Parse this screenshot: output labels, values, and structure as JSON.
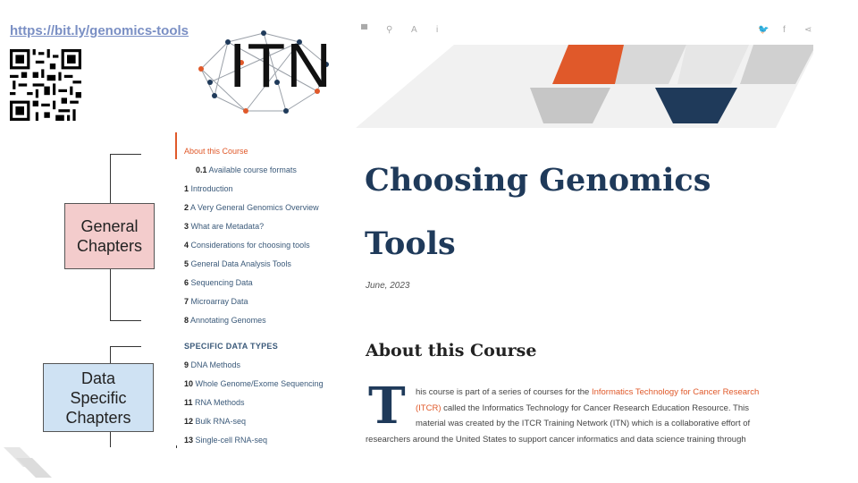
{
  "slide": {
    "link_text": "https://bit.ly/genomics-tools",
    "logo_text": "ITN",
    "callouts": {
      "general": "General\nChapters",
      "data_specific": "Data\nSpecific\nChapters"
    }
  },
  "toolbar": {
    "left_icons": [
      "sidebar-toggle-icon",
      "search-icon",
      "font-icon",
      "info-icon"
    ],
    "right_icons": [
      "twitter-icon",
      "facebook-icon",
      "share-icon"
    ],
    "glyphs": {
      "sidebar": "▀",
      "search": "⚲",
      "font": "A",
      "info": "i",
      "twitter": "🐦",
      "facebook": "f",
      "share": "⋖"
    }
  },
  "sidebar": {
    "items": [
      {
        "num": "",
        "label": "About this Course",
        "active": true
      },
      {
        "num": "0.1",
        "label": "Available course formats"
      },
      {
        "num": "1",
        "label": "Introduction"
      },
      {
        "num": "2",
        "label": "A Very General Genomics Overview"
      },
      {
        "num": "3",
        "label": "What are Metadata?"
      },
      {
        "num": "4",
        "label": "Considerations for choosing tools"
      },
      {
        "num": "5",
        "label": "General Data Analysis Tools"
      },
      {
        "num": "6",
        "label": "Sequencing Data"
      },
      {
        "num": "7",
        "label": "Microarray Data"
      },
      {
        "num": "8",
        "label": "Annotating Genomes"
      }
    ],
    "section_header": "SPECIFIC DATA TYPES",
    "specific_items": [
      {
        "num": "9",
        "label": "DNA Methods"
      },
      {
        "num": "10",
        "label": "Whole Genome/Exome Sequencing"
      },
      {
        "num": "11",
        "label": "RNA Methods"
      },
      {
        "num": "12",
        "label": "Bulk RNA-seq"
      },
      {
        "num": "13",
        "label": "Single-cell RNA-seq"
      }
    ]
  },
  "main": {
    "title_line1": "Choosing Genomics",
    "title_line2": "Tools",
    "date": "June, 2023",
    "section_title": "About this Course",
    "dropcap": "T",
    "para": {
      "l1_text": "his course is part of a series of courses for the ",
      "l1_link": "Informatics Technology for Cancer Research",
      "l2_link": "(ITCR)",
      "l2_text": " called the Informatics Technology for Cancer Research Education Resource. This",
      "l3_text": "material was created by the ITCR Training Network (ITN) which is a collaborative effort of",
      "l4_text": "researchers around the United States to support cancer informatics and data science training through"
    }
  },
  "colors": {
    "accent_orange": "#e0592a",
    "navy": "#1f3a5a",
    "callout_pink": "#f3cccc",
    "callout_blue": "#cfe2f3"
  }
}
